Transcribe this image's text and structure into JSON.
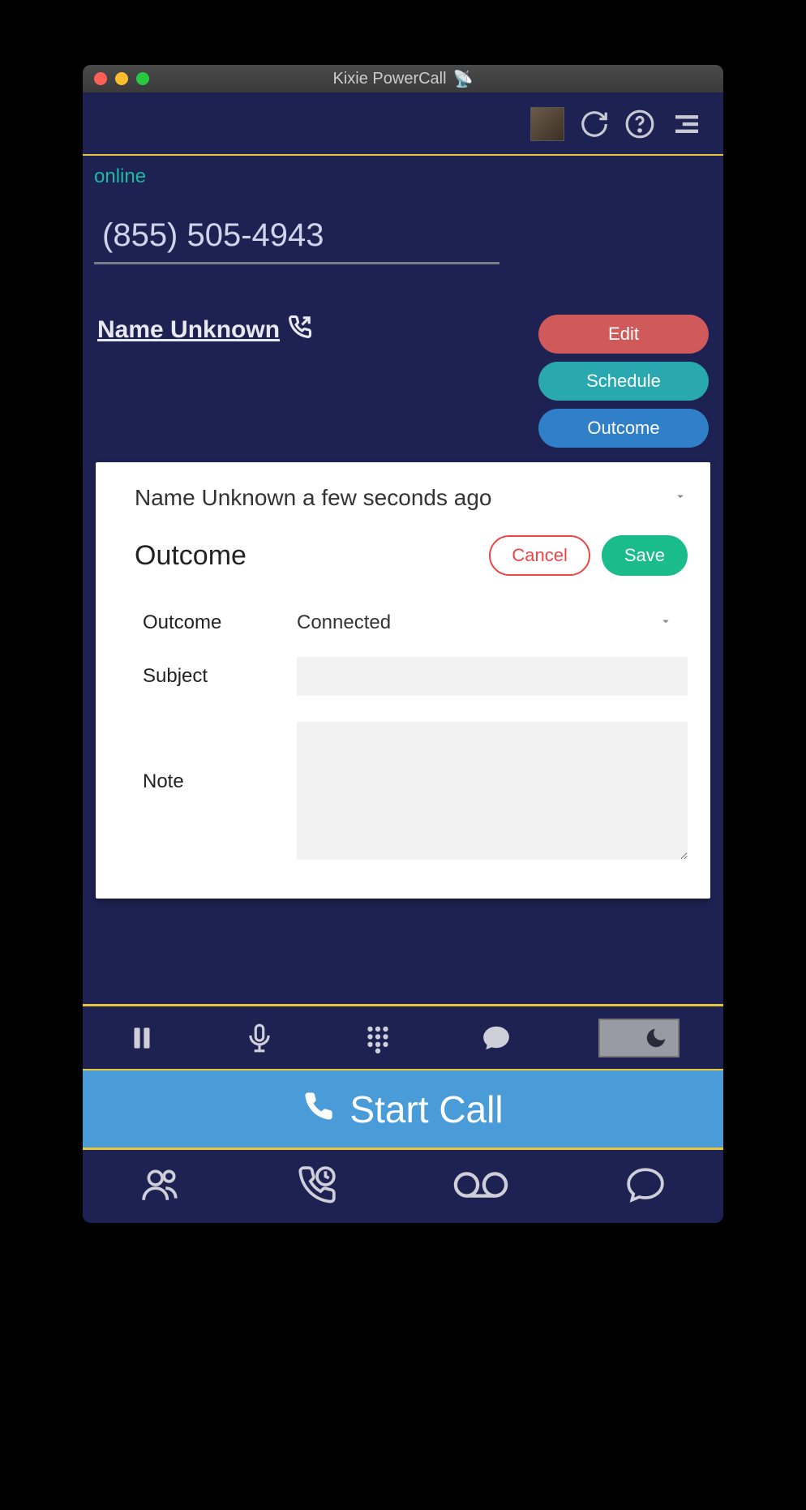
{
  "window": {
    "title": "Kixie PowerCall"
  },
  "status": {
    "text": "online"
  },
  "phone": {
    "value": "(855) 505-4943"
  },
  "contact": {
    "name": "Name Unknown"
  },
  "actions": {
    "edit": "Edit",
    "schedule": "Schedule",
    "outcome": "Outcome"
  },
  "card": {
    "header": "Name Unknown a few seconds ago",
    "title": "Outcome",
    "cancel": "Cancel",
    "save": "Save",
    "fields": {
      "outcome_label": "Outcome",
      "outcome_value": "Connected",
      "subject_label": "Subject",
      "subject_value": "",
      "note_label": "Note",
      "note_value": ""
    }
  },
  "start_call": "Start Call"
}
